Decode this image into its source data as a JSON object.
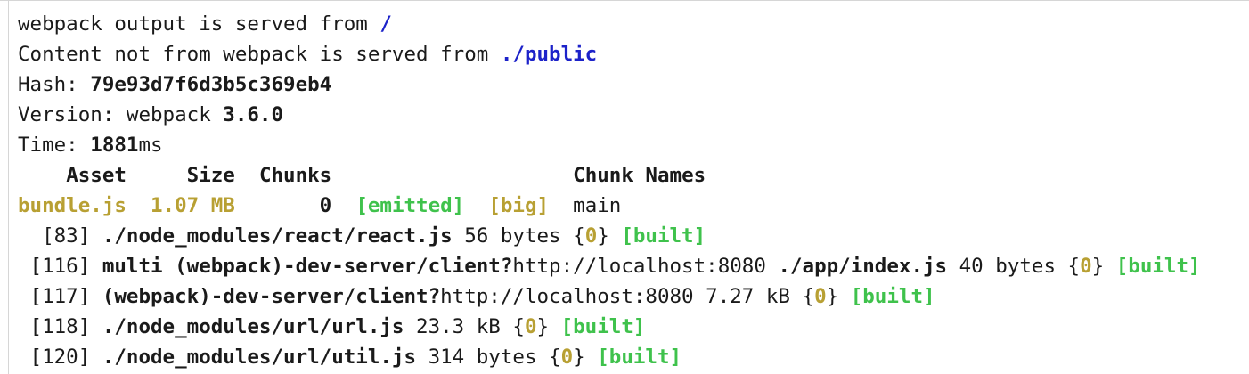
{
  "server": {
    "output_prefix": "webpack output is served from ",
    "output_path": "/",
    "content_prefix": "Content not from webpack is served from ",
    "content_path": "./public"
  },
  "stats": {
    "hash_label": "Hash: ",
    "hash_value": "79e93d7f6d3b5c369eb4",
    "version_label": "Version: webpack ",
    "version_value": "3.6.0",
    "time_label": "Time: ",
    "time_value": "1881",
    "time_unit": "ms"
  },
  "asset_table": {
    "headers": {
      "asset": "Asset",
      "size": "Size",
      "chunks": "Chunks",
      "chunk_names": "Chunk Names"
    },
    "rows": [
      {
        "asset": "bundle.js",
        "size": "1.07 MB",
        "chunks": "0",
        "emitted": "[emitted]",
        "big": "[big]",
        "chunk_name": "main"
      }
    ]
  },
  "modules": [
    {
      "id": "[83]",
      "name_bold": "./node_modules/react/react.js",
      "name_regular": "",
      "name_tail_bold": "",
      "size": "56 bytes",
      "chunk": "0",
      "status": "[built]"
    },
    {
      "id": "[116]",
      "name_bold": "multi (webpack)-dev-server/client?",
      "name_regular": "http://localhost:8080",
      "name_tail_bold": "./app/index.js",
      "size": "40 bytes",
      "chunk": "0",
      "status": "[built]"
    },
    {
      "id": "[117]",
      "name_bold": "(webpack)-dev-server/client?",
      "name_regular": "http://localhost:8080",
      "name_tail_bold": "",
      "size": "7.27 kB",
      "chunk": "0",
      "status": "[built]"
    },
    {
      "id": "[118]",
      "name_bold": "./node_modules/url/url.js",
      "name_regular": "",
      "name_tail_bold": "",
      "size": "23.3 kB",
      "chunk": "0",
      "status": "[built]"
    },
    {
      "id": "[120]",
      "name_bold": "./node_modules/url/util.js",
      "name_regular": "",
      "name_tail_bold": "",
      "size": "314 bytes",
      "chunk": "0",
      "status": "[built]"
    }
  ],
  "colors": {
    "path_blue": "#1c22c9",
    "asset_gold": "#b8a033",
    "built_green": "#3fc24c",
    "text": "#1a1a1a"
  }
}
